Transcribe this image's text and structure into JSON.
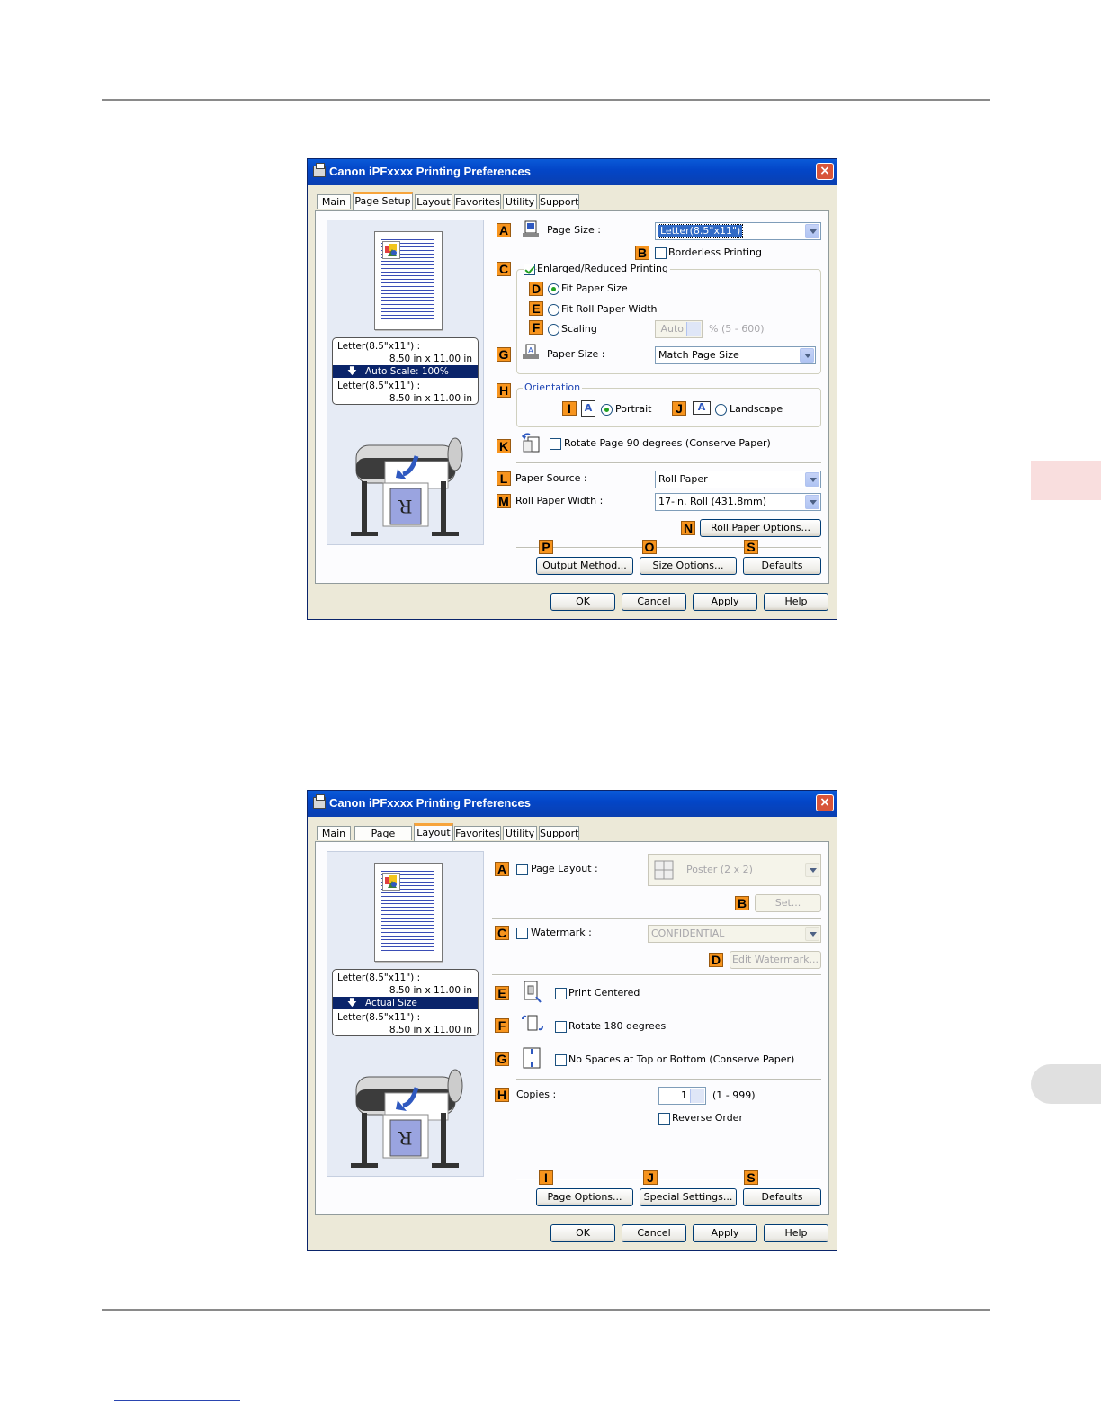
{
  "dialog1": {
    "title": "Canon iPFxxxx Printing Preferences",
    "close": "×",
    "tabs": [
      "Main",
      "Page Setup",
      "Layout",
      "Favorites",
      "Utility",
      "Support"
    ],
    "active_tab": "Page Setup",
    "preview": {
      "row1": "Letter(8.5\"x11\") :",
      "row2": "8.50 in x 11.00 in",
      "row3": "Auto Scale: 100%",
      "row4": "Letter(8.5\"x11\") :",
      "row5": "8.50 in x 11.00 in"
    },
    "marks": {
      "A": "A",
      "B": "B",
      "C": "C",
      "D": "D",
      "E": "E",
      "F": "F",
      "G": "G",
      "H": "H",
      "I": "I",
      "J": "J",
      "K": "K",
      "L": "L",
      "M": "M",
      "N": "N",
      "P": "P",
      "O": "O",
      "S": "S"
    },
    "page_size_label": "Page Size :",
    "page_size_value": "Letter(8.5\"x11\")",
    "borderless": "Borderless Printing",
    "enlarged": "Enlarged/Reduced Printing",
    "fit_paper": "Fit Paper Size",
    "fit_roll": "Fit Roll Paper Width",
    "scaling": "Scaling",
    "scaling_value": "Auto",
    "scaling_range": "% (5 - 600)",
    "paper_size_label": "Paper Size :",
    "paper_size_value": "Match Page Size",
    "orientation": "Orientation",
    "portrait": "Portrait",
    "landscape": "Landscape",
    "orient_icon_letter": "A",
    "rotate": "Rotate Page 90 degrees (Conserve Paper)",
    "paper_source_label": "Paper Source :",
    "paper_source_value": "Roll Paper",
    "roll_width_label": "Roll Paper Width :",
    "roll_width_value": "17-in. Roll (431.8mm)",
    "roll_options": "Roll Paper Options...",
    "output_method": "Output Method...",
    "size_options": "Size Options...",
    "defaults": "Defaults",
    "ok": "OK",
    "cancel": "Cancel",
    "apply": "Apply",
    "help": "Help"
  },
  "dialog2": {
    "title": "Canon iPFxxxx Printing Preferences",
    "close": "×",
    "tabs": [
      "Main",
      "Page Setup",
      "Layout",
      "Favorites",
      "Utility",
      "Support"
    ],
    "active_tab": "Layout",
    "preview": {
      "row1": "Letter(8.5\"x11\") :",
      "row2": "8.50 in x 11.00 in",
      "row3": "Actual Size",
      "row4": "Letter(8.5\"x11\") :",
      "row5": "8.50 in x 11.00 in"
    },
    "marks": {
      "A": "A",
      "B": "B",
      "C": "C",
      "D": "D",
      "E": "E",
      "F": "F",
      "G": "G",
      "H": "H",
      "I": "I",
      "J": "J",
      "S": "S"
    },
    "page_layout": "Page Layout :",
    "page_layout_value": "Poster (2 x 2)",
    "set": "Set...",
    "watermark": "Watermark :",
    "watermark_value": "CONFIDENTIAL",
    "edit_watermark": "Edit Watermark...",
    "print_centered": "Print Centered",
    "rotate180": "Rotate 180 degrees",
    "no_spaces": "No Spaces at Top or Bottom (Conserve Paper)",
    "copies_label": "Copies :",
    "copies_value": "1",
    "copies_range": "(1 - 999)",
    "reverse": "Reverse Order",
    "page_options": "Page Options...",
    "special_settings": "Special Settings...",
    "defaults": "Defaults",
    "ok": "OK",
    "cancel": "Cancel",
    "apply": "Apply",
    "help": "Help"
  },
  "colors": {
    "callout": "#f7941d",
    "titlebar": "#0346c8",
    "edge_tab_top": "#f9dede",
    "edge_tab_bottom": "#e0e0e0"
  }
}
